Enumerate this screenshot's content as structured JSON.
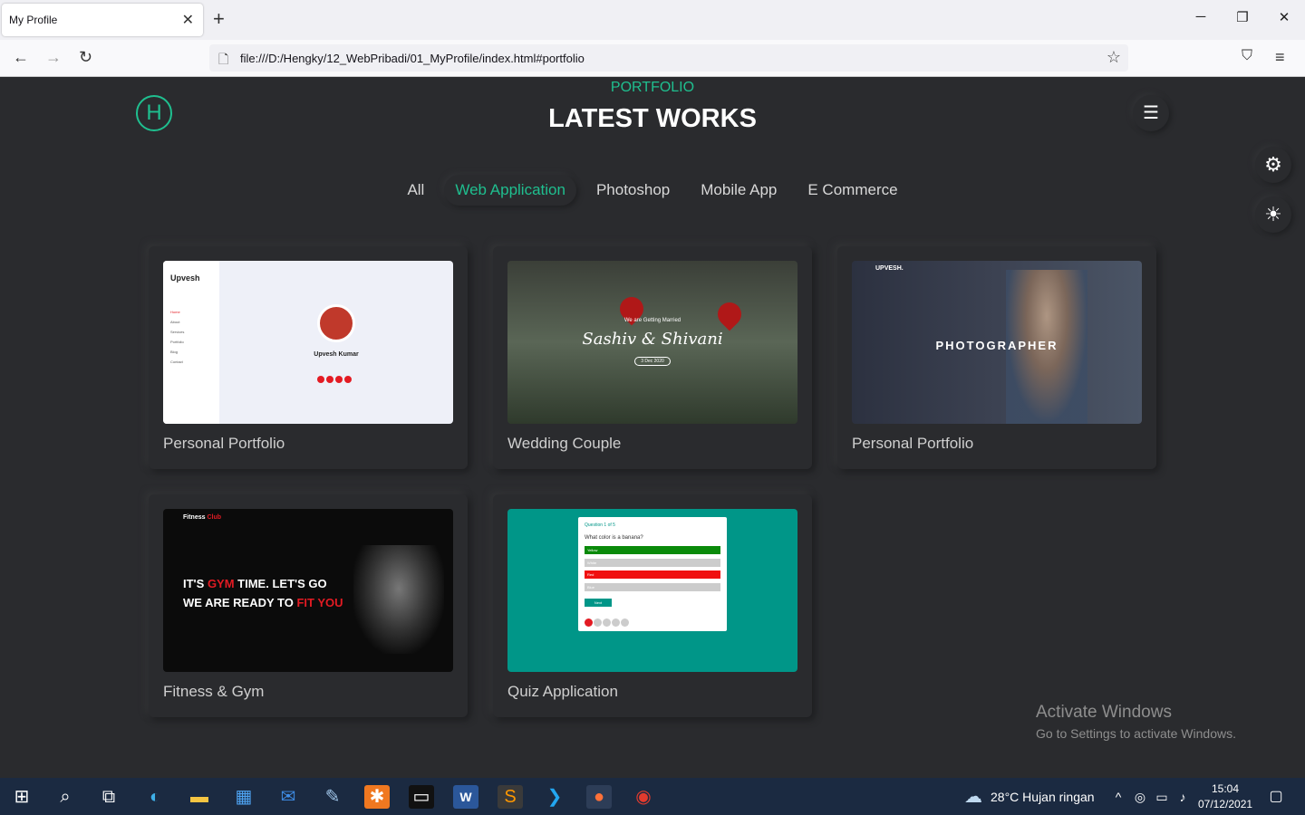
{
  "browser": {
    "tab_title": "My Profile",
    "tab_close": "✕",
    "new_tab": "+",
    "url": "file:///D:/Hengky/12_WebPribadi/01_MyProfile/index.html#portfolio",
    "win_min": "─",
    "win_restore": "❐",
    "win_close": "✕"
  },
  "page": {
    "logo_letter": "H",
    "section_label": "PORTFOLIO",
    "section_title": "LATEST WORKS",
    "filters": [
      "All",
      "Web Application",
      "Photoshop",
      "Mobile App",
      "E Commerce"
    ],
    "active_filter": "Web Application",
    "cards": [
      {
        "title": "Personal Portfolio",
        "thumb": "upvesh-portfolio"
      },
      {
        "title": "Wedding Couple",
        "thumb": "wedding"
      },
      {
        "title": "Personal Portfolio",
        "thumb": "photographer"
      },
      {
        "title": "Fitness & Gym",
        "thumb": "fitness"
      },
      {
        "title": "Quiz Application",
        "thumb": "quiz"
      }
    ],
    "thumb1": {
      "brand": "Upvesh",
      "menu": [
        "Home",
        "About",
        "Services",
        "Portfolio",
        "Blog",
        "Contact"
      ],
      "name": "Upvesh Kumar"
    },
    "thumb2": {
      "small": "We are Getting Married",
      "script": "Sashiv & Shivani",
      "date": "3 Dec 2020"
    },
    "thumb3": {
      "brand": "UPVESH.",
      "headline": "PHOTOGRAPHER"
    },
    "thumb4": {
      "brand_a": "Fitness ",
      "brand_b": "Club",
      "line1_a": "IT'S ",
      "line1_b": "GYM",
      "line1_c": " TIME. LET'S GO",
      "line2_a": "WE ARE READY TO ",
      "line2_b": "FIT YOU"
    },
    "thumb5": {
      "question_num": "Question 1 of 5",
      "question": "What color is a banana?",
      "options": [
        "Yellow",
        "White",
        "Red",
        "Blue"
      ],
      "next": "Next"
    }
  },
  "watermark": {
    "line1": "Activate Windows",
    "line2": "Go to Settings to activate Windows."
  },
  "taskbar": {
    "weather": "28°C  Hujan ringan",
    "time": "15:04",
    "date": "07/12/2021"
  },
  "colors": {
    "accent": "#1fbf8f",
    "background": "#2a2b2e"
  }
}
